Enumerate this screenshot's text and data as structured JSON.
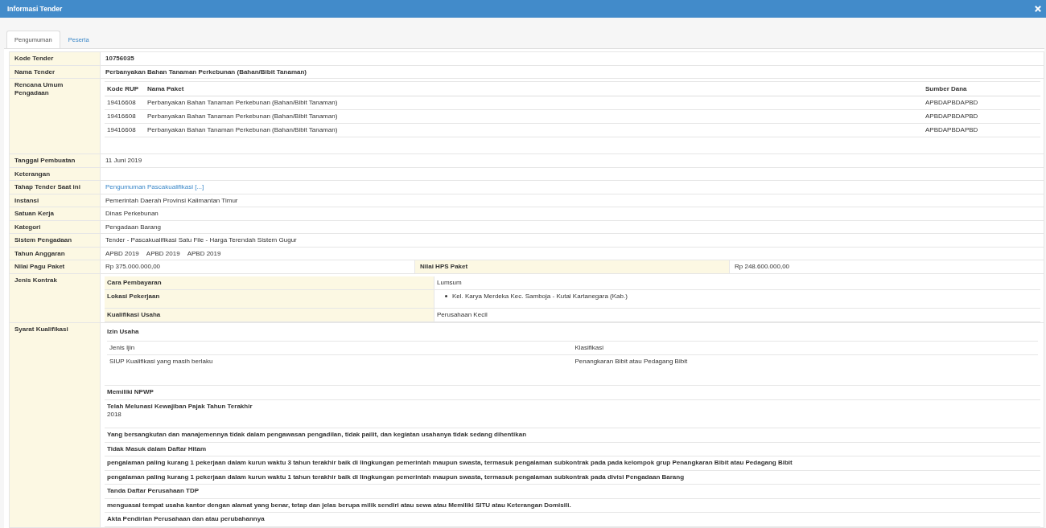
{
  "window": {
    "title": "Informasi Tender"
  },
  "tabs": [
    {
      "label": "Pengumuman",
      "selected": true
    },
    {
      "label": "Peserta",
      "selected": false
    }
  ],
  "rows": [
    {
      "kind": "bold",
      "label": "Kode Tender",
      "value": "10756035"
    },
    {
      "kind": "bold",
      "label": "Nama Tender",
      "value": "Perbanyakan Bahan Tanaman Perkebunan (Bahan/Bibit Tanaman)"
    },
    {
      "kind": "rup",
      "label": "Rencana Umum Pengadaan",
      "columns": [
        "Kode RUP",
        "Nama Paket",
        "Sumber Dana"
      ],
      "items": [
        [
          "19416608",
          "Perbanyakan Bahan Tanaman Perkebunan (Bahan/Bibit Tanaman)",
          "APBDAPBDAPBD"
        ],
        [
          "19416608",
          "Perbanyakan Bahan Tanaman Perkebunan (Bahan/Bibit Tanaman)",
          "APBDAPBDAPBD"
        ],
        [
          "19416608",
          "Perbanyakan Bahan Tanaman Perkebunan (Bahan/Bibit Tanaman)",
          "APBDAPBDAPBD"
        ]
      ]
    },
    {
      "kind": "text",
      "label": "Tanggal Pembuatan",
      "value": "11 Juni 2019"
    },
    {
      "kind": "text",
      "label": "Keterangan"
    },
    {
      "kind": "link",
      "label": "Tahap Tender Saat ini",
      "value": "Pengumuman Pascakualifikasi [...]"
    },
    {
      "kind": "text",
      "label": "Instansi",
      "value": "Pemerintah Daerah Provinsi Kalimantan Timur"
    },
    {
      "kind": "text",
      "label": "Satuan Kerja",
      "value": "Dinas Perkebunan"
    },
    {
      "kind": "text",
      "label": "Kategori",
      "value": "Pengadaan Barang"
    },
    {
      "kind": "text",
      "label": "Sistem Pengadaan",
      "value": "Tender - Pascakualifikasi Satu File - Harga Terendah Sistem Gugur"
    },
    {
      "kind": "multi",
      "label": "Tahun Anggaran",
      "values": [
        "APBD 2019",
        "APBD 2019",
        "APBD 2019"
      ]
    },
    {
      "kind": "pair",
      "label": "Nilai Pagu Paket",
      "value": "Rp 375.000.000,00",
      "label_2": "Nilai HPS Paket",
      "value_2": "Rp 248.600.000,00"
    },
    {
      "kind": "contract",
      "label": "Jenis Kontrak",
      "items": [
        {
          "label": "Cara Pembayaran",
          "value": "Lumsum"
        },
        {
          "label": "Lokasi Pekerjaan",
          "bullets": [
            "Kel. Karya Merdeka Kec. Samboja - Kutai Kartanegara (Kab.)"
          ]
        },
        {
          "label": "Kualifikasi Usaha",
          "value": "Perusahaan Kecil"
        }
      ]
    },
    {
      "kind": "requirements",
      "label": "Syarat Kualifikasi",
      "items": [
        {
          "title": "Izin Usaha",
          "columns": [
            "Jenis Ijin",
            "Klasifikasi"
          ],
          "table": [
            [
              "SIUP Kualifikasi yang masih berlaku",
              "Penangkaran Bibit atau Pedagang Bibit"
            ]
          ]
        },
        {
          "title": "Memiliki NPWP"
        },
        {
          "title": "Telah Melunasi Kewajiban Pajak Tahun Terakhir",
          "value": "2018"
        },
        {
          "title": "Yang bersangkutan dan manajemennya tidak dalam pengawasan pengadilan, tidak pailit, dan kegiatan usahanya tidak sedang dihentikan"
        },
        {
          "title": "Tidak Masuk dalam Daftar Hitam"
        },
        {
          "title": "pengalaman paling kurang 1 pekerjaan dalam kurun waktu 3 tahun terakhir baik di lingkungan pemerintah maupun swasta, termasuk pengalaman subkontrak pada pada kelompok grup Penangkaran Bibit atau Pedagang Bibit"
        },
        {
          "title": "pengalaman paling kurang 1 pekerjaan dalam kurun waktu 1 tahun terakhir baik di lingkungan pemerintah maupun swasta, termasuk pengalaman subkontrak pada divisi Pengadaan Barang"
        },
        {
          "title": "Tanda Daftar Perusahaan TDP"
        },
        {
          "title": "menguasai tempat usaha kantor dengan alamat yang benar, tetap dan jelas berupa milik sendiri atau sewa atau Memiliki SITU atau Keterangan Domisili."
        },
        {
          "title": "Akta Pendirian Perusahaan dan atau perubahannya"
        }
      ]
    }
  ]
}
